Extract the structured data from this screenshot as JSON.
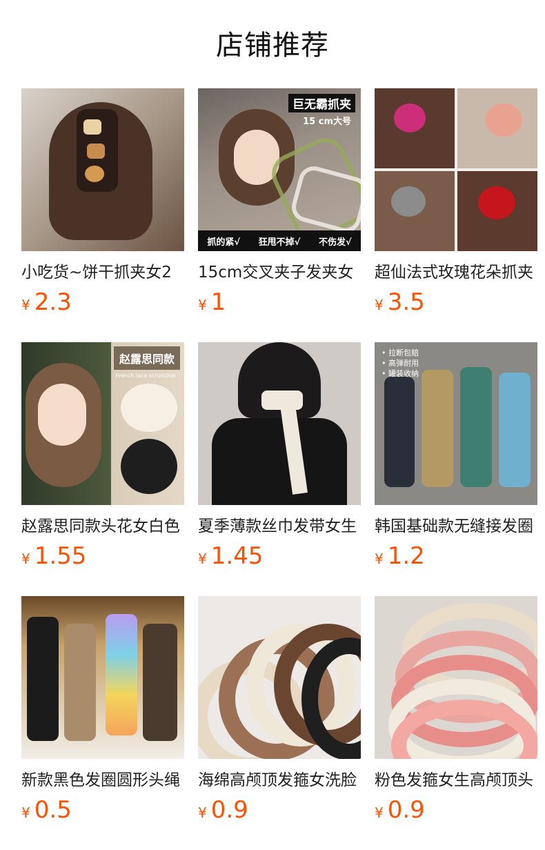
{
  "page": {
    "title": "店铺推荐"
  },
  "currency_symbol": "¥",
  "products": [
    {
      "name": "小吃货~饼干抓夹女2",
      "price": "2.3"
    },
    {
      "name": "15cm交叉夹子发夹女",
      "price": "1",
      "badge": "巨无霸抓夹",
      "subbadge": "15 cm大号",
      "features": [
        "抓的紧√",
        "狂甩不掉√",
        "不伤发√"
      ]
    },
    {
      "name": "超仙法式玫瑰花朵抓夹",
      "price": "3.5"
    },
    {
      "name": "赵露思同款头花女白色",
      "price": "1.55",
      "badge": "赵露思同款",
      "subbadge": "French lace scrunchie"
    },
    {
      "name": "夏季薄款丝巾发带女生",
      "price": "1.45"
    },
    {
      "name": "韩国基础款无缝接发圈",
      "price": "1.2",
      "notes": [
        "• 拉断包赔",
        "• 高弹耐用",
        "• 罐装收纳"
      ]
    },
    {
      "name": "新款黑色发圈圆形头绳",
      "price": "0.5"
    },
    {
      "name": "海绵高颅顶发箍女洗脸",
      "price": "0.9"
    },
    {
      "name": "粉色发箍女生高颅顶头",
      "price": "0.9"
    }
  ],
  "colors": {
    "price": "#ff5000",
    "title": "#111111",
    "name": "#222222"
  }
}
